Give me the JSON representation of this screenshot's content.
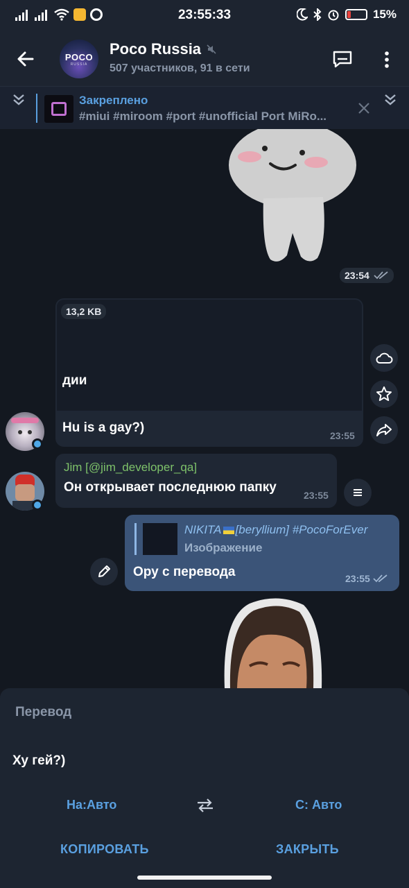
{
  "status_bar": {
    "time": "23:55:33",
    "battery": "15%"
  },
  "header": {
    "title": "Poco Russia",
    "subtitle": "507 участников, 91 в сети",
    "avatar_line1": "POCO",
    "avatar_line2": "RUSSIA"
  },
  "pinned": {
    "title": "Закреплено",
    "text": "#miui #miroom #port #unofficial  Port MiRo..."
  },
  "messages": {
    "sticker1_time": "23:54",
    "file_size": "13,2 KB",
    "partial_caption": "дии",
    "msg1_text": "Hu is a gay?)",
    "msg1_time": "23:55",
    "msg2_author": "Jim [@jim_developer_qa]",
    "msg2_text": "Он открывает последнюю папку",
    "msg2_time": "23:55",
    "reply_author": "NIKITA",
    "reply_author_tag": "[beryllium] #PocoForEver",
    "reply_type": "Изображение",
    "msg3_text": "Ору с перевода",
    "msg3_time": "23:55"
  },
  "translate_sheet": {
    "title": "Перевод",
    "text": "Ху гей?)",
    "to_lang": "На:Авто",
    "from_lang": "С: Авто",
    "copy_label": "КОПИРОВАТЬ",
    "close_label": "ЗАКРЫТЬ"
  },
  "colors": {
    "accent": "#5aa0e0",
    "incoming_bubble": "#1f2734",
    "outgoing_bubble": "#3b5478",
    "author_green": "#7ec26a"
  }
}
